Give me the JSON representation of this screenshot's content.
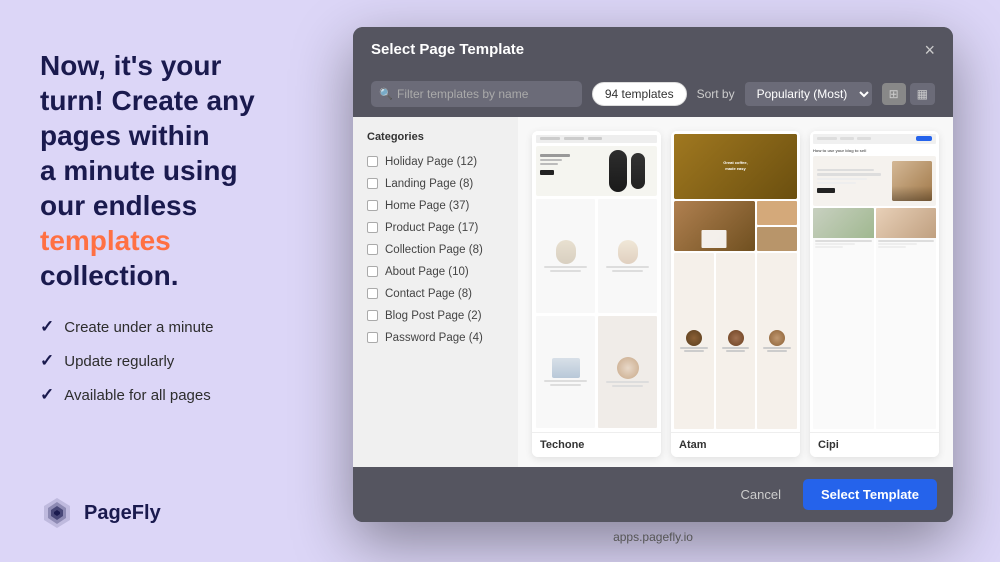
{
  "left": {
    "headline_line1": "Now, it's your",
    "headline_line2": "turn! Create any",
    "headline_line3": "pages within",
    "headline_line4": "a minute using",
    "headline_line5": "our endless",
    "headline_highlight": "templates",
    "headline_line6": "collection.",
    "checklist": [
      "Create under a minute",
      "Update regularly",
      "Available for all pages"
    ],
    "logo_text": "PageFly"
  },
  "modal": {
    "title": "Select Page Template",
    "close_label": "×",
    "search_placeholder": "Filter templates by name",
    "count_badge": "94 templates",
    "sort_label": "Sort by",
    "sort_value": "Popularity (Most)",
    "categories_title": "Categories",
    "categories": [
      {
        "name": "Holiday Page",
        "count": "(12)"
      },
      {
        "name": "Landing Page",
        "count": "(8)"
      },
      {
        "name": "Home Page",
        "count": "(37)"
      },
      {
        "name": "Product Page",
        "count": "(17)"
      },
      {
        "name": "Collection Page",
        "count": "(8)"
      },
      {
        "name": "About Page",
        "count": "(10)"
      },
      {
        "name": "Contact Page",
        "count": "(8)"
      },
      {
        "name": "Blog Post Page",
        "count": "(2)"
      },
      {
        "name": "Password Page",
        "count": "(4)"
      }
    ],
    "templates": [
      {
        "name": "Techone"
      },
      {
        "name": "Atam"
      },
      {
        "name": "Cipi"
      }
    ],
    "cancel_label": "Cancel",
    "select_label": "Select Template"
  },
  "footer": {
    "url": "apps.pagefly.io"
  }
}
